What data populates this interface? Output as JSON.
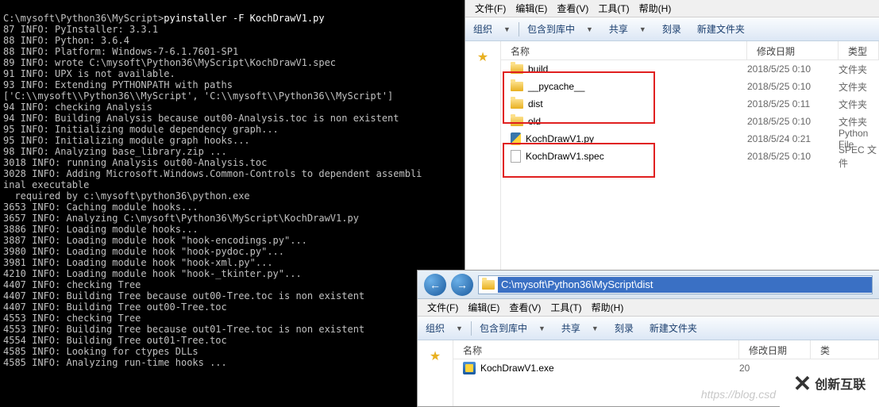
{
  "terminal": {
    "prompt": "C:\\mysoft\\Python36\\MyScript>",
    "command": "pyinstaller -F KochDrawV1.py",
    "lines": [
      "87 INFO: PyInstaller: 3.3.1",
      "88 INFO: Python: 3.6.4",
      "88 INFO: Platform: Windows-7-6.1.7601-SP1",
      "89 INFO: wrote C:\\mysoft\\Python36\\MyScript\\KochDrawV1.spec",
      "91 INFO: UPX is not available.",
      "93 INFO: Extending PYTHONPATH with paths",
      "['C:\\\\mysoft\\\\Python36\\\\MyScript', 'C:\\\\mysoft\\\\Python36\\\\MyScript']",
      "94 INFO: checking Analysis",
      "94 INFO: Building Analysis because out00-Analysis.toc is non existent",
      "95 INFO: Initializing module dependency graph...",
      "95 INFO: Initializing module graph hooks...",
      "98 INFO: Analyzing base_library.zip ...",
      "3018 INFO: running Analysis out00-Analysis.toc",
      "3028 INFO: Adding Microsoft.Windows.Common-Controls to dependent assembli",
      "inal executable",
      "  required by c:\\mysoft\\python36\\python.exe",
      "3653 INFO: Caching module hooks...",
      "3657 INFO: Analyzing C:\\mysoft\\Python36\\MyScript\\KochDrawV1.py",
      "3886 INFO: Loading module hooks...",
      "3887 INFO: Loading module hook \"hook-encodings.py\"...",
      "3980 INFO: Loading module hook \"hook-pydoc.py\"...",
      "3981 INFO: Loading module hook \"hook-xml.py\"...",
      "4210 INFO: Loading module hook \"hook-_tkinter.py\"...",
      "4407 INFO: checking Tree",
      "4407 INFO: Building Tree because out00-Tree.toc is non existent",
      "4407 INFO: Building Tree out00-Tree.toc",
      "4553 INFO: checking Tree",
      "4553 INFO: Building Tree because out01-Tree.toc is non existent",
      "4554 INFO: Building Tree out01-Tree.toc",
      "4585 INFO: Looking for ctypes DLLs",
      "4585 INFO: Analyzing run-time hooks ..."
    ]
  },
  "menu": {
    "file": "文件(F)",
    "edit": "编辑(E)",
    "view": "查看(V)",
    "tools": "工具(T)",
    "help": "帮助(H)"
  },
  "toolbar": {
    "organize": "组织",
    "include": "包含到库中",
    "share": "共享",
    "burn": "刻录",
    "newfolder": "新建文件夹"
  },
  "columns": {
    "name": "名称",
    "date": "修改日期",
    "type": "类型"
  },
  "explorer1": {
    "files": [
      {
        "name": "build",
        "date": "2018/5/25 0:10",
        "type": "文件夹",
        "icon": "folder"
      },
      {
        "name": "__pycache__",
        "date": "2018/5/25 0:10",
        "type": "文件夹",
        "icon": "folder"
      },
      {
        "name": "dist",
        "date": "2018/5/25 0:11",
        "type": "文件夹",
        "icon": "folder"
      },
      {
        "name": "old",
        "date": "2018/5/25 0:10",
        "type": "文件夹",
        "icon": "folder"
      },
      {
        "name": "KochDrawV1.py",
        "date": "2018/5/24 0:21",
        "type": "Python File",
        "icon": "py"
      },
      {
        "name": "KochDrawV1.spec",
        "date": "2018/5/25 0:10",
        "type": "SPEC 文件",
        "icon": "file"
      }
    ]
  },
  "explorer2": {
    "address": "C:\\mysoft\\Python36\\MyScript\\dist",
    "files": [
      {
        "name": "KochDrawV1.exe",
        "date": "20",
        "type": "",
        "icon": "exe"
      }
    ]
  },
  "columns2": {
    "name": "名称",
    "date": "修改日期",
    "type": "类"
  },
  "watermark": "https://blog.csd",
  "logo": "创新互联"
}
